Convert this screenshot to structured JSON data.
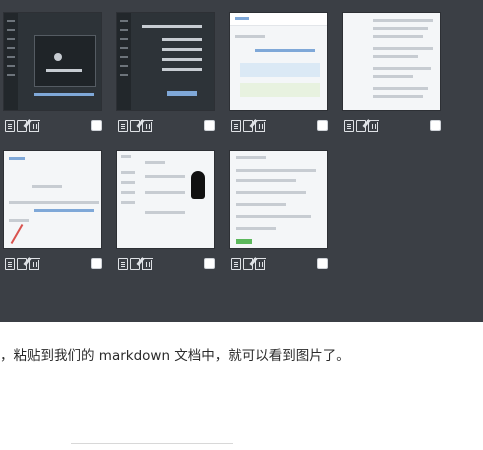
{
  "panel": {
    "background": "#3b3f45",
    "thumbnails": [
      {
        "name": "thumbnail-1",
        "style": "dark"
      },
      {
        "name": "thumbnail-2",
        "style": "dark"
      },
      {
        "name": "thumbnail-3",
        "style": "light"
      },
      {
        "name": "thumbnail-4",
        "style": "light"
      },
      {
        "name": "thumbnail-5",
        "style": "light"
      },
      {
        "name": "thumbnail-6",
        "style": "light"
      },
      {
        "name": "thumbnail-7",
        "style": "light"
      }
    ],
    "toolbar_icons": [
      "document-icon",
      "edit-icon",
      "trash-icon"
    ]
  },
  "caption": {
    "text": "，粘贴到我们的 markdown 文档中，就可以看到图片了。"
  }
}
